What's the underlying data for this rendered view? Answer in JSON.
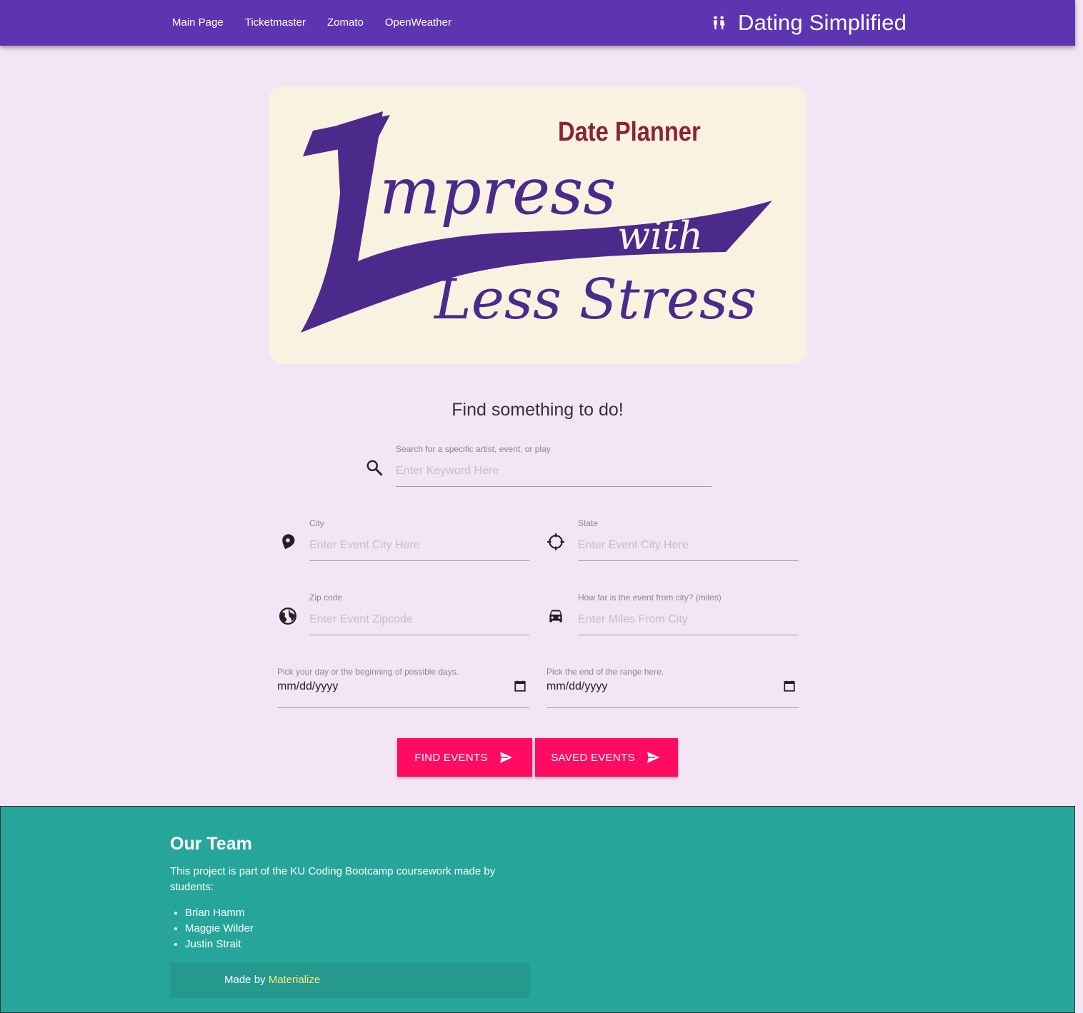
{
  "nav": {
    "links": [
      "Main Page",
      "Ticketmaster",
      "Zomato",
      "OpenWeather"
    ],
    "brand": "Dating Simplified",
    "brand_icon": "people-icon"
  },
  "hero": {
    "subtitle": "Date Planner",
    "line1": "mpress",
    "initial": "I",
    "line2": "with",
    "line3": "Less Stress",
    "colors": {
      "purple": "#4b2a8c",
      "maroon": "#8b2338",
      "cream": "#faf2e1"
    }
  },
  "search": {
    "title": "Find something to do!",
    "keyword": {
      "label": "Search for a specific artist, event, or play",
      "placeholder": "Enter Keyword Here",
      "icon": "search-icon"
    },
    "city": {
      "label": "City",
      "placeholder": "Enter Event City Here",
      "icon": "map-pin-icon"
    },
    "state": {
      "label": "State",
      "placeholder": "Enter Event City Here",
      "icon": "crosshair-icon"
    },
    "zip": {
      "label": "Zip code",
      "placeholder": "Enter Event Zipcode",
      "icon": "globe-icon"
    },
    "miles": {
      "label": "How far is the event from city? (miles)",
      "placeholder": "Enter Miles From City",
      "icon": "car-icon"
    },
    "start_date": {
      "label": "Pick your day or the beginning of possible days.",
      "value": "mm/dd/yyyy"
    },
    "end_date": {
      "label": "Pick the end of the range here.",
      "value": "mm/dd/yyyy"
    },
    "find_button": "FIND EVENTS",
    "saved_button": "SAVED EVENTS"
  },
  "footer": {
    "title": "Our Team",
    "text": "This project is part of the KU Coding Bootcamp coursework made by students:",
    "members": [
      "Brian Hamm",
      "Maggie Wilder",
      "Justin Strait"
    ],
    "made_by": "Made by ",
    "made_by_link": "Materialize"
  },
  "colors": {
    "nav_bg": "#5e35b1",
    "page_bg": "#f3e5f5",
    "button_bg": "#ff0c62",
    "footer_bg": "#26a69a",
    "link_color": "#ffe57f"
  }
}
